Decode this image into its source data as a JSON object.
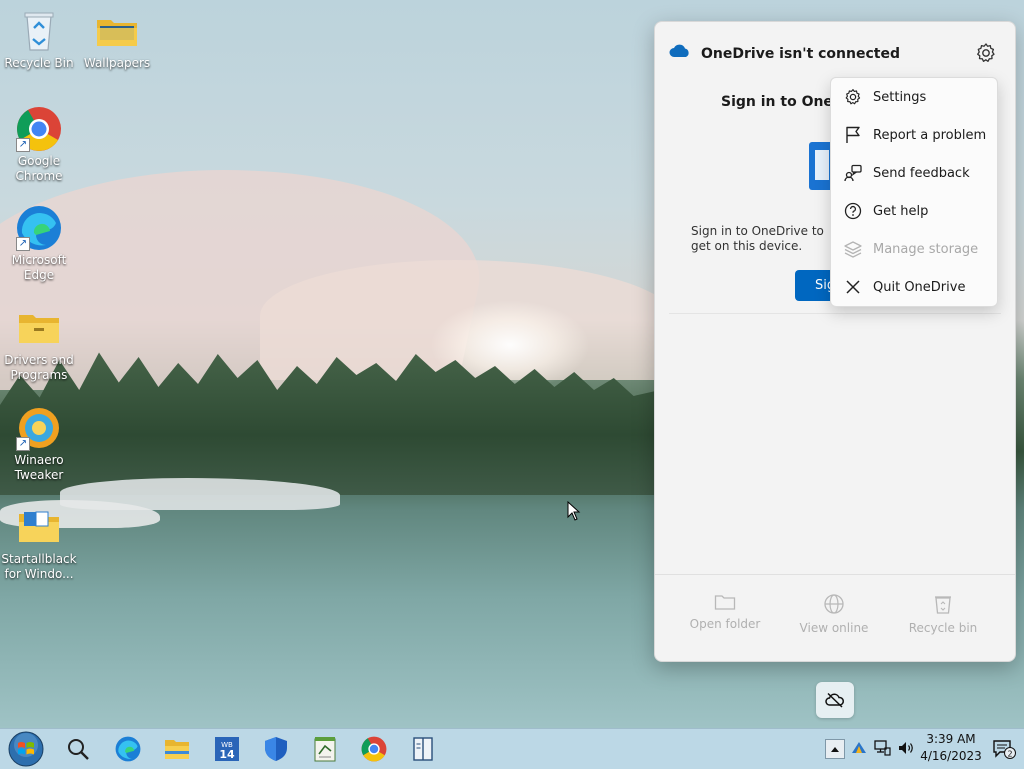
{
  "desktop": {
    "icons": [
      {
        "label": "Recycle Bin",
        "icon": "recycle-bin-icon"
      },
      {
        "label": "Wallpapers",
        "icon": "folder-icon"
      },
      {
        "label": "Google Chrome",
        "icon": "chrome-icon"
      },
      {
        "label": "Microsoft Edge",
        "icon": "edge-icon"
      },
      {
        "label": "Drivers and Programs",
        "icon": "folder-icon"
      },
      {
        "label": "Winaero Tweaker",
        "icon": "winaero-icon"
      },
      {
        "label": "Startallblack for Windo...",
        "icon": "folder-icon"
      }
    ]
  },
  "onedrive": {
    "title": "OneDrive isn't connected",
    "signin_title": "Sign in to OneD",
    "description": "Sign in to OneDrive to get on this device.",
    "signin_button": "Sig",
    "footer": {
      "open_folder": "Open folder",
      "view_online": "View online",
      "recycle_bin": "Recycle bin"
    }
  },
  "menu": {
    "items": [
      {
        "label": "Settings",
        "icon": "gear-icon",
        "enabled": true
      },
      {
        "label": "Report a problem",
        "icon": "flag-icon",
        "enabled": true
      },
      {
        "label": "Send feedback",
        "icon": "feedback-icon",
        "enabled": true
      },
      {
        "label": "Get help",
        "icon": "help-icon",
        "enabled": true
      },
      {
        "label": "Manage storage",
        "icon": "stack-icon",
        "enabled": false
      },
      {
        "label": "Quit OneDrive",
        "icon": "close-icon",
        "enabled": true
      }
    ]
  },
  "taskbar": {
    "time": "3:39 AM",
    "date": "4/16/2023",
    "notification_count": "2",
    "pinned": [
      "start-orb-icon",
      "search-icon",
      "edge-icon",
      "file-explorer-icon",
      "winaero-14-icon",
      "defender-icon",
      "notepad-icon",
      "chrome-icon",
      "reader-icon"
    ],
    "winaero_badge": "14"
  },
  "colors": {
    "accent": "#0067c0",
    "taskbar": "#bcd8e6",
    "flyout": "#f3f3f3"
  }
}
